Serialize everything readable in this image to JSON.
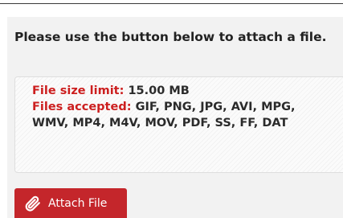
{
  "upload": {
    "instruction": "Please use the button below to attach a file.",
    "size_limit_label": "File size limit:",
    "size_limit_value": "15.00 MB",
    "files_accepted_label": "Files accepted:",
    "files_accepted_value": "GIF, PNG, JPG, AVI, MPG, WMV, MP4, M4V, MOV, PDF, SS, FF, DAT",
    "attach_button_label": "Attach File"
  },
  "colors": {
    "accent_red": "#cc1f1f",
    "button_background": "#c4262b",
    "panel_background": "#f2f2f2"
  },
  "icons": {
    "attach_icon": "paperclip-icon"
  }
}
